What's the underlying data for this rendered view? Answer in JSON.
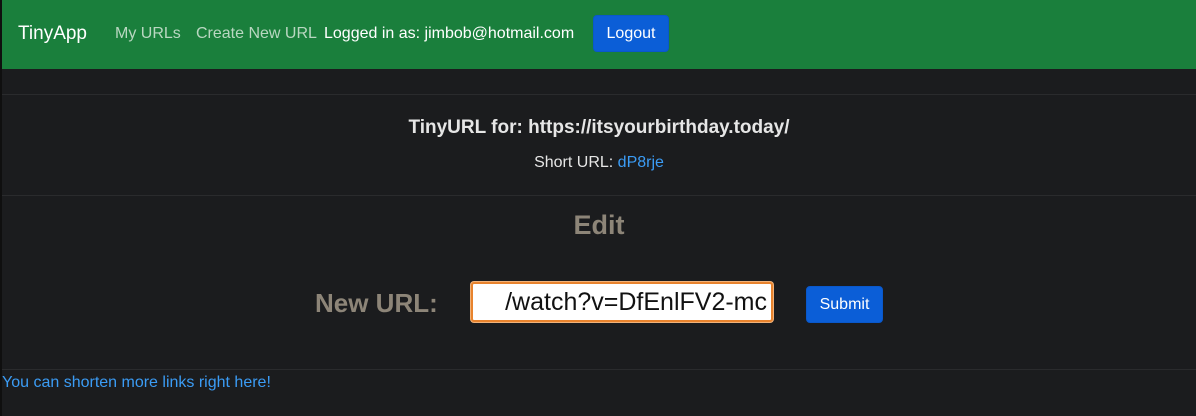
{
  "navbar": {
    "brand": "TinyApp",
    "links": [
      {
        "label": "My URLs"
      },
      {
        "label": "Create New URL"
      }
    ],
    "logged_in_text": "Logged in as: jimbob@hotmail.com",
    "logout_label": "Logout",
    "background_color": "#1a7f3c"
  },
  "url_info": {
    "title": "TinyURL for: https://itsyourbirthday.today/",
    "short_url_label": "Short URL:",
    "short_url_code": "dP8rje"
  },
  "edit_form": {
    "heading": "Edit",
    "new_url_label": "New URL:",
    "input_value": "/watch?v=DfEnlFV2-mc",
    "submit_label": "Submit"
  },
  "footer": {
    "link_text": "You can shorten more links right here!"
  }
}
